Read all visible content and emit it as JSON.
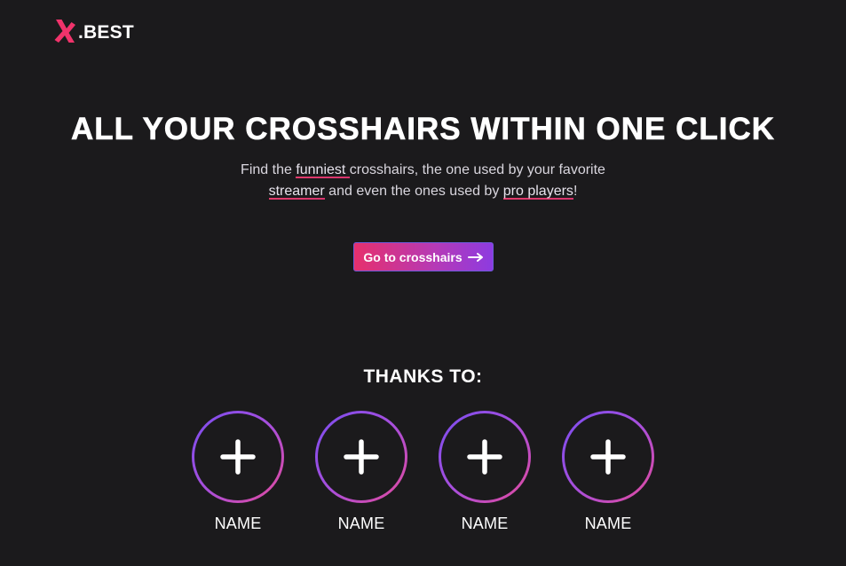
{
  "header": {
    "logo_text": ".BEST",
    "logo_icon": "x-mark-icon",
    "logo_color": "#f0336b"
  },
  "hero": {
    "title": "ALL YOUR CROSSHAIRS WITHIN ONE CLICK",
    "desc_line1_a": "Find the ",
    "desc_line1_hl": "funniest ",
    "desc_line1_b": "crosshairs, the one used by your favorite",
    "desc_line2_hl1": "streamer",
    "desc_line2_a": " and even the ones used by ",
    "desc_line2_hl2": "pro players",
    "desc_line2_b": "!",
    "cta_label": "Go to crosshairs",
    "cta_icon": "arrow-right-icon",
    "accent_pink": "#e6306d",
    "accent_purple": "#8d3be0"
  },
  "thanks": {
    "title": "THANKS TO:",
    "supporters": [
      {
        "name": "NAME",
        "icon": "plus-icon"
      },
      {
        "name": "NAME",
        "icon": "plus-icon"
      },
      {
        "name": "NAME",
        "icon": "plus-icon"
      },
      {
        "name": "NAME",
        "icon": "plus-icon"
      }
    ]
  },
  "colors": {
    "background": "#1b1a1c",
    "text": "#ffffff"
  }
}
